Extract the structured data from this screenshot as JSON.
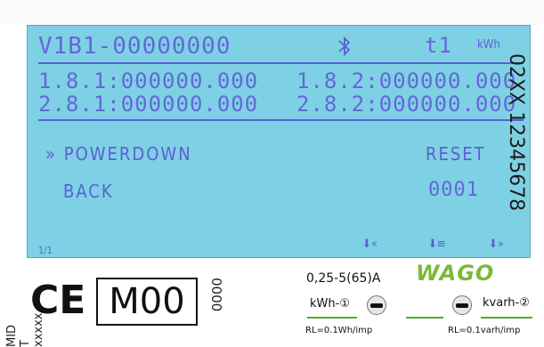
{
  "lcd": {
    "meter_id": "V1B1-00000000",
    "bluetooth_icon": "bluetooth-icon",
    "tariff": "t1",
    "unit": "kWh",
    "registers": [
      {
        "label": "1.8.1:",
        "value": "000000.000"
      },
      {
        "label": "1.8.2:",
        "value": "000000.000"
      },
      {
        "label": "2.8.1:",
        "value": "000000.000"
      },
      {
        "label": "2.8.2:",
        "value": "000000.000"
      }
    ],
    "menu": {
      "cursor": "»",
      "powerdown": "POWERDOWN",
      "reset": "RESET",
      "back": "BACK",
      "code": "0001"
    },
    "page": "1/1",
    "softkeys": [
      "⬇«",
      "⬇≡",
      "⬇»"
    ],
    "colors": {
      "background": "#7ed1e4",
      "segments": "#5b5fd4"
    }
  },
  "label_left": "MID T xxxxx",
  "serial_right": "02XX 12345678",
  "ce_mark": "CE",
  "m_mark": "M00",
  "small_code": "0000",
  "current_rating": "0,25-5(65)A",
  "brand": "WAGO",
  "led1_label": "kWh-①",
  "led2_label": "kvarh-②",
  "rl1": "RL=0.1Wh/imp",
  "rl2": "RL=0.1varh/imp"
}
